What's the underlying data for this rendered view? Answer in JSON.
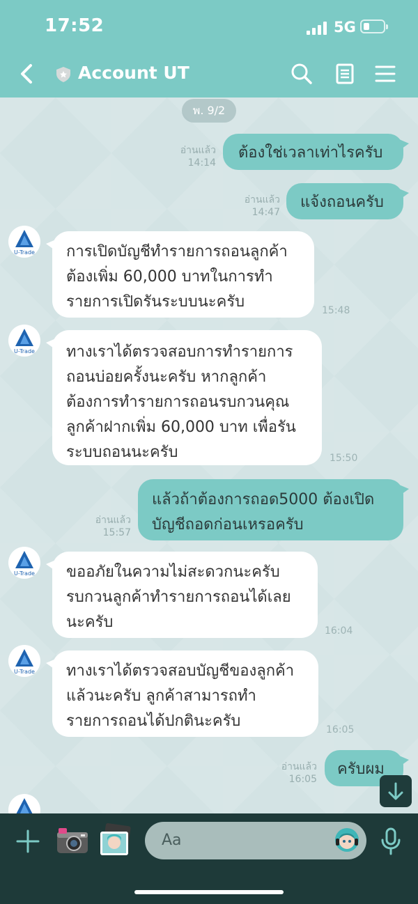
{
  "status_bar": {
    "time": "17:52",
    "network": "5G"
  },
  "header": {
    "title": "Account UT"
  },
  "chat": {
    "date_label": "พ. 9/2",
    "messages": [
      {
        "dir": "out",
        "text": "ต้องใช่เวลาเท่าไรครับ",
        "read": "อ่านแล้ว",
        "time": "14:14"
      },
      {
        "dir": "out",
        "text": "แจ้งถอนครับ",
        "read": "อ่านแล้ว",
        "time": "14:47"
      },
      {
        "dir": "in",
        "text": "การเปิดบัญชีทำรายการถอนลูกค้า\nต้องเพิ่ม 60,000 บาทในการทำ\nรายการเปิดรันระบบนะครับ",
        "time": "15:48"
      },
      {
        "dir": "in",
        "text": "ทางเราได้ตรวจสอบการทำรายการ\nถอนบ่อยครั้งนะครับ หากลูกค้า\nต้องการทำรายการถอนรบกวนคุณ\nลูกค้าฝากเพิ่ม 60,000 บาท เพื่อรัน\nระบบถอนนะครับ",
        "time": "15:50"
      },
      {
        "dir": "out",
        "text": "แล้วถ้าต้องการถอด5000 ต้องเปิด\nบัญชีถอดก่อนเหรอครับ",
        "read": "อ่านแล้ว",
        "time": "15:57"
      },
      {
        "dir": "in",
        "text": "ขออภัยในความไม่สะดวกนะครับ\nรบกวนลูกค้าทำรายการถอนได้เลย\nนะครับ",
        "time": "16:04"
      },
      {
        "dir": "in",
        "text": "ทางเราได้ตรวจสอบบัญชีของลูกค้า\nแล้วนะครับ ลูกค้าสามารถทำ\nรายการถอนได้ปกตินะครับ",
        "time": "16:05"
      },
      {
        "dir": "out",
        "text": "ครับผม",
        "read": "อ่านแล้ว",
        "time": "16:05"
      }
    ],
    "avatar_label": "U-Trade"
  },
  "composer": {
    "placeholder": "Aa"
  },
  "colors": {
    "accent": "#7ccac5",
    "bottom_bar": "#1e3a39",
    "chat_bg": "#d3e3e4"
  },
  "icons": [
    "back-icon",
    "shield-icon",
    "search-icon",
    "notes-icon",
    "menu-icon",
    "plus-icon",
    "camera-icon",
    "photo-icon",
    "sticker-icon",
    "mic-icon",
    "arrow-down-icon"
  ]
}
